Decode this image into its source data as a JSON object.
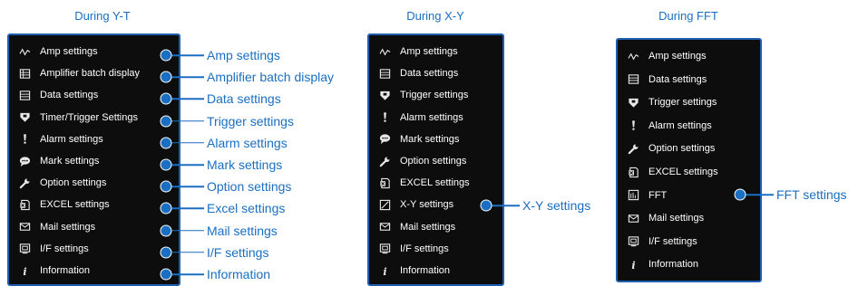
{
  "captions": {
    "yt": "During Y-T",
    "xy": "During X-Y",
    "fft": "During FFT"
  },
  "yt_menu": [
    {
      "label": "Amp settings",
      "icon": "wave-icon"
    },
    {
      "label": "Amplifier batch display",
      "icon": "table-icon"
    },
    {
      "label": "Data settings",
      "icon": "list-icon"
    },
    {
      "label": "Timer/Trigger Settings",
      "icon": "trigger-icon"
    },
    {
      "label": "Alarm settings",
      "icon": "alarm-icon"
    },
    {
      "label": "Mark settings",
      "icon": "comment-icon"
    },
    {
      "label": "Option settings",
      "icon": "wrench-icon"
    },
    {
      "label": "EXCEL settings",
      "icon": "excel-icon"
    },
    {
      "label": "Mail settings",
      "icon": "mail-icon"
    },
    {
      "label": "I/F settings",
      "icon": "interface-icon"
    },
    {
      "label": "Information",
      "icon": "info-icon"
    }
  ],
  "yt_callouts": [
    "Amp settings",
    "Amplifier batch display",
    "Data settings",
    "Trigger settings",
    "Alarm settings",
    "Mark settings",
    "Option settings",
    "Excel settings",
    "Mail settings",
    "I/F settings",
    "Information"
  ],
  "xy_menu": [
    {
      "label": "Amp settings",
      "icon": "wave-icon"
    },
    {
      "label": "Data settings",
      "icon": "list-icon"
    },
    {
      "label": "Trigger settings",
      "icon": "trigger-icon"
    },
    {
      "label": "Alarm settings",
      "icon": "alarm-icon"
    },
    {
      "label": "Mark settings",
      "icon": "comment-icon"
    },
    {
      "label": "Option settings",
      "icon": "wrench-icon"
    },
    {
      "label": "EXCEL settings",
      "icon": "excel-icon"
    },
    {
      "label": "X-Y settings",
      "icon": "xy-icon"
    },
    {
      "label": "Mail settings",
      "icon": "mail-icon"
    },
    {
      "label": "I/F settings",
      "icon": "interface-icon"
    },
    {
      "label": "Information",
      "icon": "info-icon"
    }
  ],
  "xy_callout": "X-Y settings",
  "fft_menu": [
    {
      "label": "Amp settings",
      "icon": "wave-icon"
    },
    {
      "label": "Data settings",
      "icon": "list-icon"
    },
    {
      "label": "Trigger settings",
      "icon": "trigger-icon"
    },
    {
      "label": "Alarm settings",
      "icon": "alarm-icon"
    },
    {
      "label": "Option settings",
      "icon": "wrench-icon"
    },
    {
      "label": "EXCEL settings",
      "icon": "excel-icon"
    },
    {
      "label": "FFT",
      "icon": "fft-icon"
    },
    {
      "label": "Mail settings",
      "icon": "mail-icon"
    },
    {
      "label": "I/F settings",
      "icon": "interface-icon"
    },
    {
      "label": "Information",
      "icon": "info-icon"
    }
  ],
  "fft_callout": "FFT settings",
  "colors": {
    "accent": "#1a6fc2",
    "panel": "#0d0d0d",
    "border": "#1d5fb0"
  }
}
